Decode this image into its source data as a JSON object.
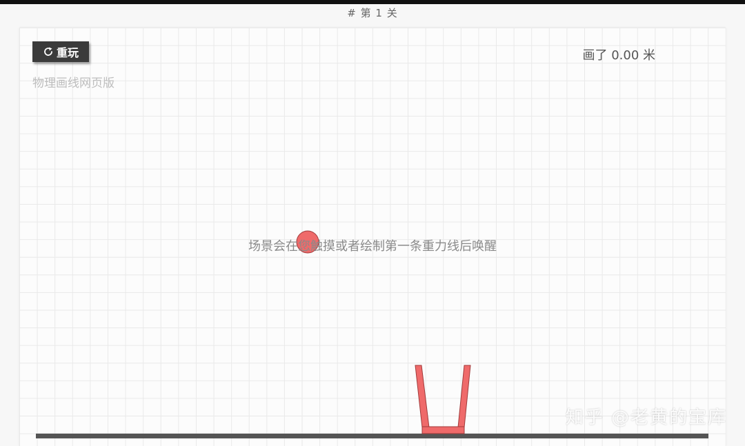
{
  "header": {
    "level_title": "# 第 1 关"
  },
  "toolbar": {
    "replay_label": "重玩",
    "replay_icon": "refresh-icon"
  },
  "game": {
    "subtitle": "物理画线网页版",
    "distance_text": "画了 0.00 米",
    "hint_text": "场景会在您触摸或者绘制第一条重力线后唤醒"
  },
  "watermark": {
    "text": "知乎 @老黄的宝库"
  },
  "colors": {
    "ball": "#ef6a6a",
    "cup": "#ef6a6a",
    "outline": "#a03a3a",
    "ground": "#555555",
    "button_bg": "#3b3b3b"
  }
}
